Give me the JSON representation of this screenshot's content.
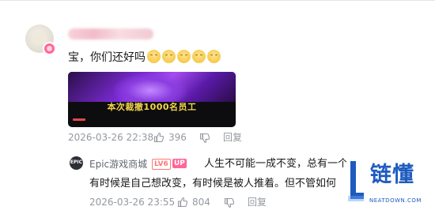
{
  "comment": {
    "text": "宝，你们还好吗",
    "emoji_count": 5,
    "emoji_icon": "smiling-emoji",
    "video": {
      "caption": "本次裁撤1000名员工"
    },
    "timestamp": "2026-03-26 22:38",
    "likes": "396",
    "reply_label": "回复"
  },
  "reply": {
    "username": "Epic游戏商城",
    "level": "LV6",
    "up_badge": "UP",
    "avatar_text": "EPIC",
    "text_line1": "人生不可能一成不变，总有一个",
    "text_line2": "有时候是自己想改变，有时候是被人推着。但不管如何",
    "timestamp": "2026-03-26 23:55",
    "likes": "804",
    "reply_label": "回复"
  },
  "watermark": {
    "cn": "链懂",
    "en": "NEATDOWN.COM"
  },
  "colors": {
    "accent_pink": "#ff6699",
    "level_red": "#fe7676",
    "caption_yellow": "#f7d64a",
    "watermark_blue": "#1e5bbf",
    "meta_grey": "#9499a0"
  }
}
